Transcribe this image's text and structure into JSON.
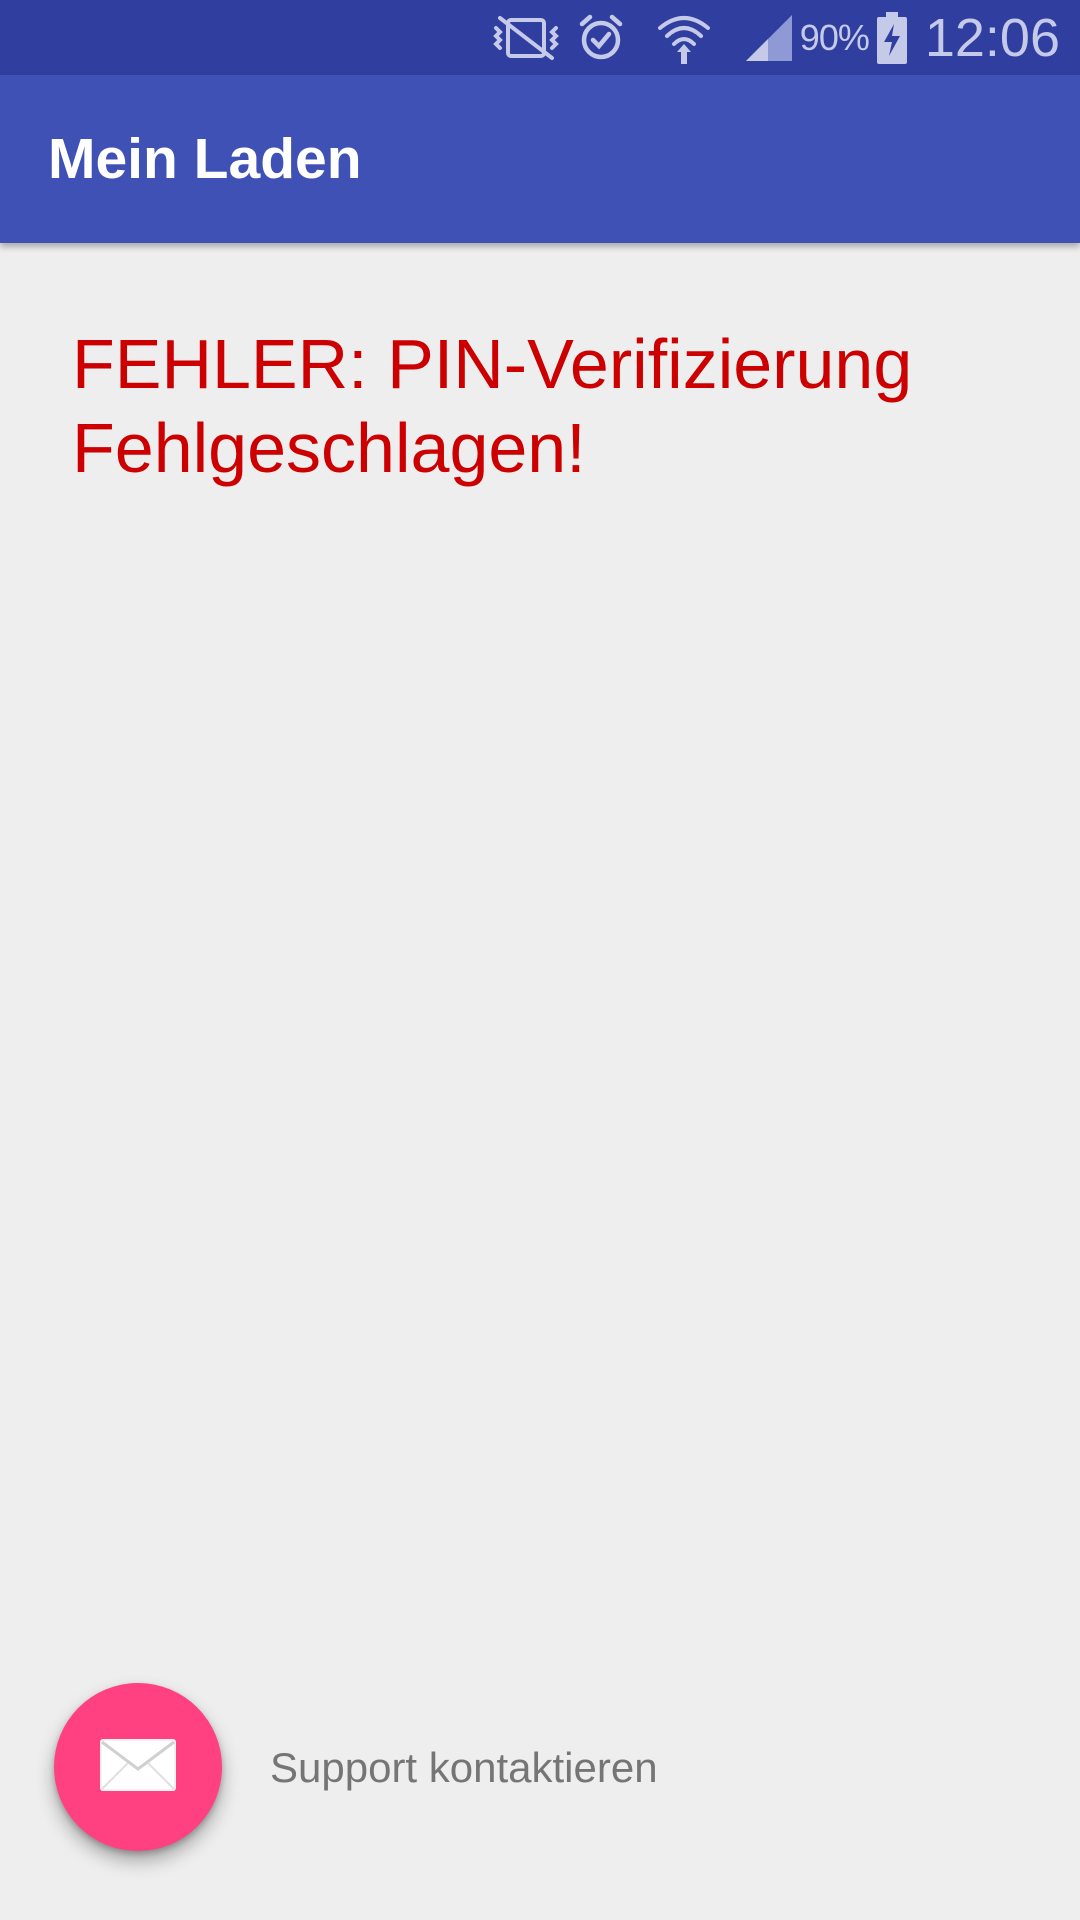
{
  "status_bar": {
    "icons": [
      "vibrate-icon",
      "alarm-icon",
      "wifi-icon",
      "cell-signal-icon",
      "battery-charging-icon"
    ],
    "battery_percent": "90%",
    "time": "12:06"
  },
  "app_bar": {
    "title": "Mein Laden"
  },
  "main": {
    "error_message": "FEHLER: PIN-Verifizierung Fehlgeschlagen!"
  },
  "support": {
    "fab_icon": "mail-icon",
    "label": "Support kontaktieren"
  },
  "colors": {
    "status_bar": "#303f9f",
    "app_bar": "#3f51b5",
    "error_text": "#cc0000",
    "fab": "#ff4081",
    "background": "#eeeeee"
  }
}
